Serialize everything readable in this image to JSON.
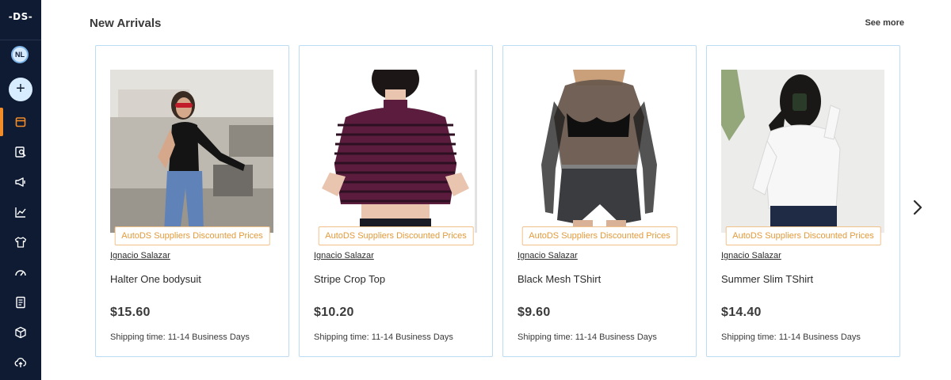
{
  "sidebar": {
    "logo": "-DS-",
    "avatar_initials": "NL",
    "add_label": "+",
    "nav": [
      {
        "icon": "store-icon"
      },
      {
        "icon": "search-product-icon"
      },
      {
        "icon": "megaphone-icon"
      },
      {
        "icon": "chart-line-icon"
      },
      {
        "icon": "shirt-icon"
      },
      {
        "icon": "speedometer-icon"
      },
      {
        "icon": "document-icon"
      },
      {
        "icon": "package-icon"
      },
      {
        "icon": "cloud-upload-icon"
      }
    ],
    "accent_color": "#f28c28"
  },
  "section": {
    "title": "New Arrivals",
    "see_more": "See more"
  },
  "products": [
    {
      "badge": "AutoDS Suppliers Discounted Prices",
      "supplier": "Ignacio Salazar",
      "name": "Halter One bodysuit",
      "price": "$15.60",
      "shipping": "Shipping time: 11-14 Business Days"
    },
    {
      "badge": "AutoDS Suppliers Discounted Prices",
      "supplier": "Ignacio Salazar",
      "name": "Stripe Crop Top",
      "price": "$10.20",
      "shipping": "Shipping time: 11-14 Business Days"
    },
    {
      "badge": "AutoDS Suppliers Discounted Prices",
      "supplier": "Ignacio Salazar",
      "name": "Black Mesh TShirt",
      "price": "$9.60",
      "shipping": "Shipping time: 11-14 Business Days"
    },
    {
      "badge": "AutoDS Suppliers Discounted Prices",
      "supplier": "Ignacio Salazar",
      "name": "Summer Slim TShirt",
      "price": "$14.40",
      "shipping": "Shipping time: 11-14 Business Days"
    }
  ]
}
